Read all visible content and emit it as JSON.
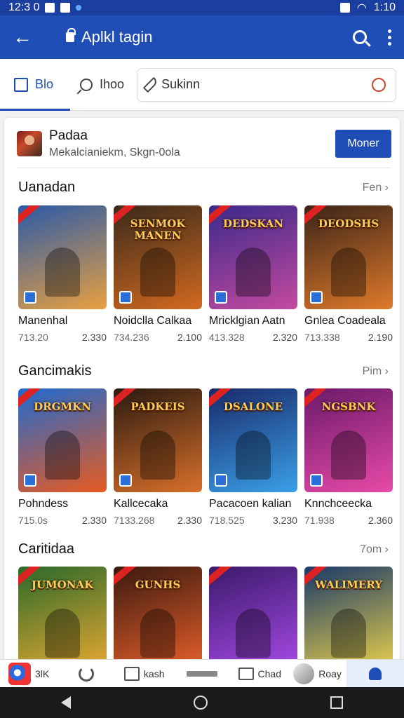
{
  "status_bar": {
    "time": "12:3 0",
    "right_time": "1:10"
  },
  "appbar": {
    "title": "Aplkl tagin",
    "back_icon": "back-arrow-icon"
  },
  "tabs": [
    {
      "label": "Blo",
      "icon": "box-icon"
    },
    {
      "label": "Ihoo",
      "icon": "search-icon"
    }
  ],
  "search": {
    "label": "Sukinn",
    "icon": "pen-icon"
  },
  "profile": {
    "name": "Padaa",
    "subtitle": "Mekalcianiekm, Skgn-0ola",
    "button": "Moner"
  },
  "sections": [
    {
      "title": "Uanadan",
      "more": "Fen",
      "items": [
        {
          "name": "Manenhal",
          "meta_left": "713.20",
          "meta_right": "2.330",
          "art": "",
          "colors": [
            "#2a5aa8",
            "#e8a040"
          ]
        },
        {
          "name": "Noidclla Calkaa",
          "meta_left": "734.236",
          "meta_right": "2.100",
          "art": "SENMOK MANEN",
          "colors": [
            "#3a2a1a",
            "#d36a20"
          ]
        },
        {
          "name": "Mricklgian Aatn",
          "meta_left": "413.328",
          "meta_right": "2.320",
          "art": "DEDSKAN",
          "colors": [
            "#3a2a8a",
            "#c44aa0"
          ]
        },
        {
          "name": "Gnlea Coadeala",
          "meta_left": "713.338",
          "meta_right": "2.190",
          "art": "DEODSHS",
          "colors": [
            "#3a2418",
            "#e07a2a"
          ]
        }
      ]
    },
    {
      "title": "Gancimakis",
      "more": "Pim",
      "items": [
        {
          "name": "Pohndess",
          "meta_left": "715.0s",
          "meta_right": "2.330",
          "art": "DRGMKN",
          "colors": [
            "#1f6ad0",
            "#e85a20"
          ]
        },
        {
          "name": "Kallcecaka",
          "meta_left": "7133.268",
          "meta_right": "2.330",
          "art": "PADKEIS",
          "colors": [
            "#2a1a10",
            "#d8702a"
          ]
        },
        {
          "name": "Pacacoen kalian",
          "meta_left": "718.525",
          "meta_right": "3.230",
          "art": "DSALONE",
          "colors": [
            "#1a2a6a",
            "#3aa0e8"
          ]
        },
        {
          "name": "Knnchceecka",
          "meta_left": "71.938",
          "meta_right": "2.360",
          "art": "NGSBNK",
          "colors": [
            "#6a1a6a",
            "#e84aa8"
          ]
        }
      ]
    },
    {
      "title": "Caritidaa",
      "more": "7om",
      "items": [
        {
          "name": "",
          "meta_left": "",
          "meta_right": "",
          "art": "JUMONAK",
          "colors": [
            "#2a6a2a",
            "#e8a830"
          ]
        },
        {
          "name": "",
          "meta_left": "",
          "meta_right": "",
          "art": "GUNHS",
          "colors": [
            "#3a1a10",
            "#e8602a"
          ]
        },
        {
          "name": "",
          "meta_left": "",
          "meta_right": "",
          "art": "",
          "colors": [
            "#3a1a6a",
            "#a84ae8"
          ]
        },
        {
          "name": "",
          "meta_left": "",
          "meta_right": "",
          "art": "WALIMERY",
          "colors": [
            "#1a3a6a",
            "#e8d04a"
          ]
        }
      ]
    }
  ],
  "bottom_nav": [
    {
      "label": "3lK",
      "icon": "app-icon"
    },
    {
      "label": "",
      "icon": "tools-icon"
    },
    {
      "label": "kash",
      "icon": "square-icon"
    },
    {
      "label": "",
      "icon": "bar-icon"
    },
    {
      "label": "Chad",
      "icon": "picture-icon"
    },
    {
      "label": "Roay",
      "icon": "avatar-icon"
    },
    {
      "label": "",
      "icon": "person-icon"
    }
  ],
  "accent": "#1f4fb6"
}
